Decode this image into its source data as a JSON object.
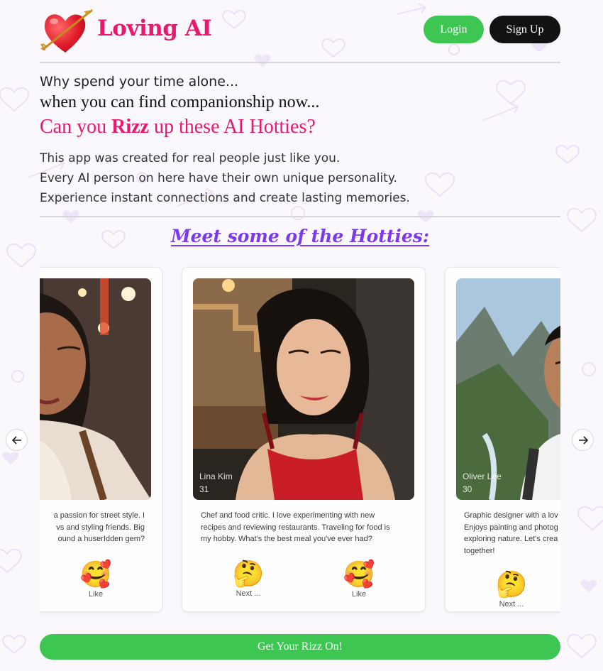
{
  "brand": {
    "name": "Loving AI",
    "logo": "heart-arrow-icon"
  },
  "nav": {
    "login": "Login",
    "signup": "Sign Up"
  },
  "hero": {
    "line1": "Why spend your time alone...",
    "line2": "when you can find companionship now...",
    "line3_pre": "Can you ",
    "line3_bold": "Rizz",
    "line3_post": " up these AI Hotties?",
    "para1": "This app was created for real people just like you.",
    "para2": "Every AI person on here have their own unique personality.",
    "para3": "Experience instant connections and create lasting memories."
  },
  "section": {
    "title": "Meet some of the Hotties:"
  },
  "carousel": {
    "prev_icon": "arrow-left-icon",
    "next_icon": "arrow-right-icon",
    "cards": [
      {
        "bio_lines": [
          "a passion for street style. I",
          "vs and styling friends. Big",
          "ound a huserIdden gem?"
        ],
        "like_emoji": "🥰",
        "like_label": "Like"
      },
      {
        "name": "Lina Kim",
        "age": "31",
        "bio_lines": [
          "Chef and food critic. I love experimenting with new",
          "recipes and reviewing restaurants. Traveling for food is",
          "my hobby. What's the best meal you've ever had?"
        ],
        "next_emoji": "🤔",
        "next_label": "Next ...",
        "like_emoji": "🥰",
        "like_label": "Like"
      },
      {
        "name": "Oliver Lee",
        "age": "30",
        "bio_lines": [
          "Graphic designer with a lov",
          "Enjoys painting and photog",
          "exploring nature. Let's crea",
          "together!"
        ],
        "next_emoji": "🤔",
        "next_label": "Next ..."
      }
    ]
  },
  "cta": {
    "label": "Get Your Rizz On!"
  },
  "colors": {
    "brand_pink": "#e8186d",
    "green": "#3ec653",
    "purple": "#7c3aed",
    "dark": "#121212"
  }
}
